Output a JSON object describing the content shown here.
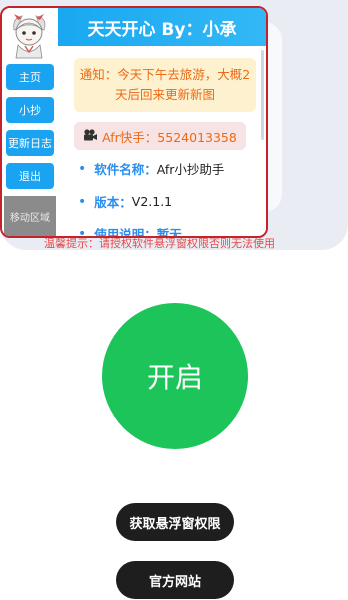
{
  "sidebar": {
    "items": [
      {
        "label": "主页"
      },
      {
        "label": "小抄"
      },
      {
        "label": "更新日志"
      },
      {
        "label": "退出"
      }
    ],
    "move_label": "移动区域"
  },
  "header": {
    "title": "天天开心 By：小承"
  },
  "notice": {
    "text": "通知：今天下午去旅游，大概2天后回来更新新图"
  },
  "contact": {
    "text": "Afr快手：5524013358",
    "icon": "video-camera-icon"
  },
  "info": [
    {
      "key": "软件名称：",
      "value": "Afr小抄助手"
    },
    {
      "key": "版本：",
      "value": "V2.1.1"
    },
    {
      "key": "使用说明：",
      "value": "暂无"
    }
  ],
  "tip": "温馨提示：请授权软件悬浮窗权限否则无法使用",
  "start_button": "开启",
  "buttons": {
    "permission": "获取悬浮窗权限",
    "website": "官方网站"
  },
  "colors": {
    "accent": "#1aa3f0",
    "start": "#1cc45a",
    "border": "#c4232b",
    "notice_text": "#ec6a16",
    "tip_text": "#e64a4a"
  }
}
